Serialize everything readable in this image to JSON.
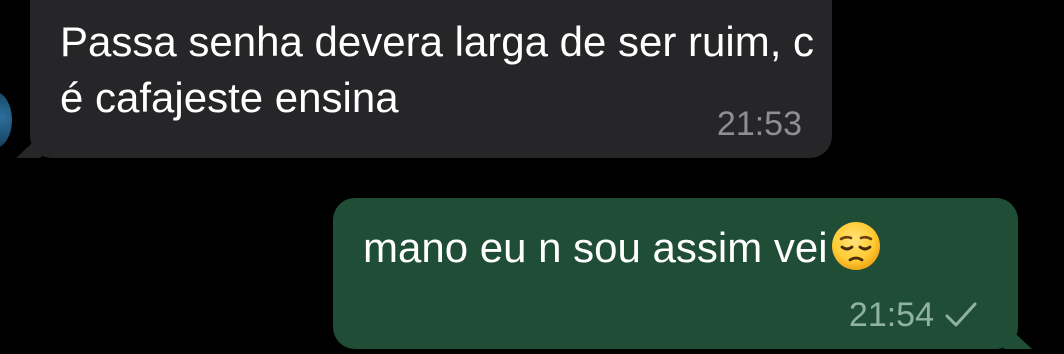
{
  "messages": {
    "incoming": {
      "text": "Passa senha devera larga de ser ruim, c é cafajeste ensina",
      "time": "21:53"
    },
    "outgoing": {
      "text": "mano eu n sou assim vei",
      "emoji": "pensive-face-emoji",
      "time": "21:54",
      "status_icon": "single-check-icon"
    }
  },
  "colors": {
    "background": "#000000",
    "incoming_bubble": "#262628",
    "outgoing_bubble": "#1f4d35",
    "text": "#ffffff",
    "incoming_time": "#8e8e93",
    "outgoing_time": "#8fb39f"
  }
}
